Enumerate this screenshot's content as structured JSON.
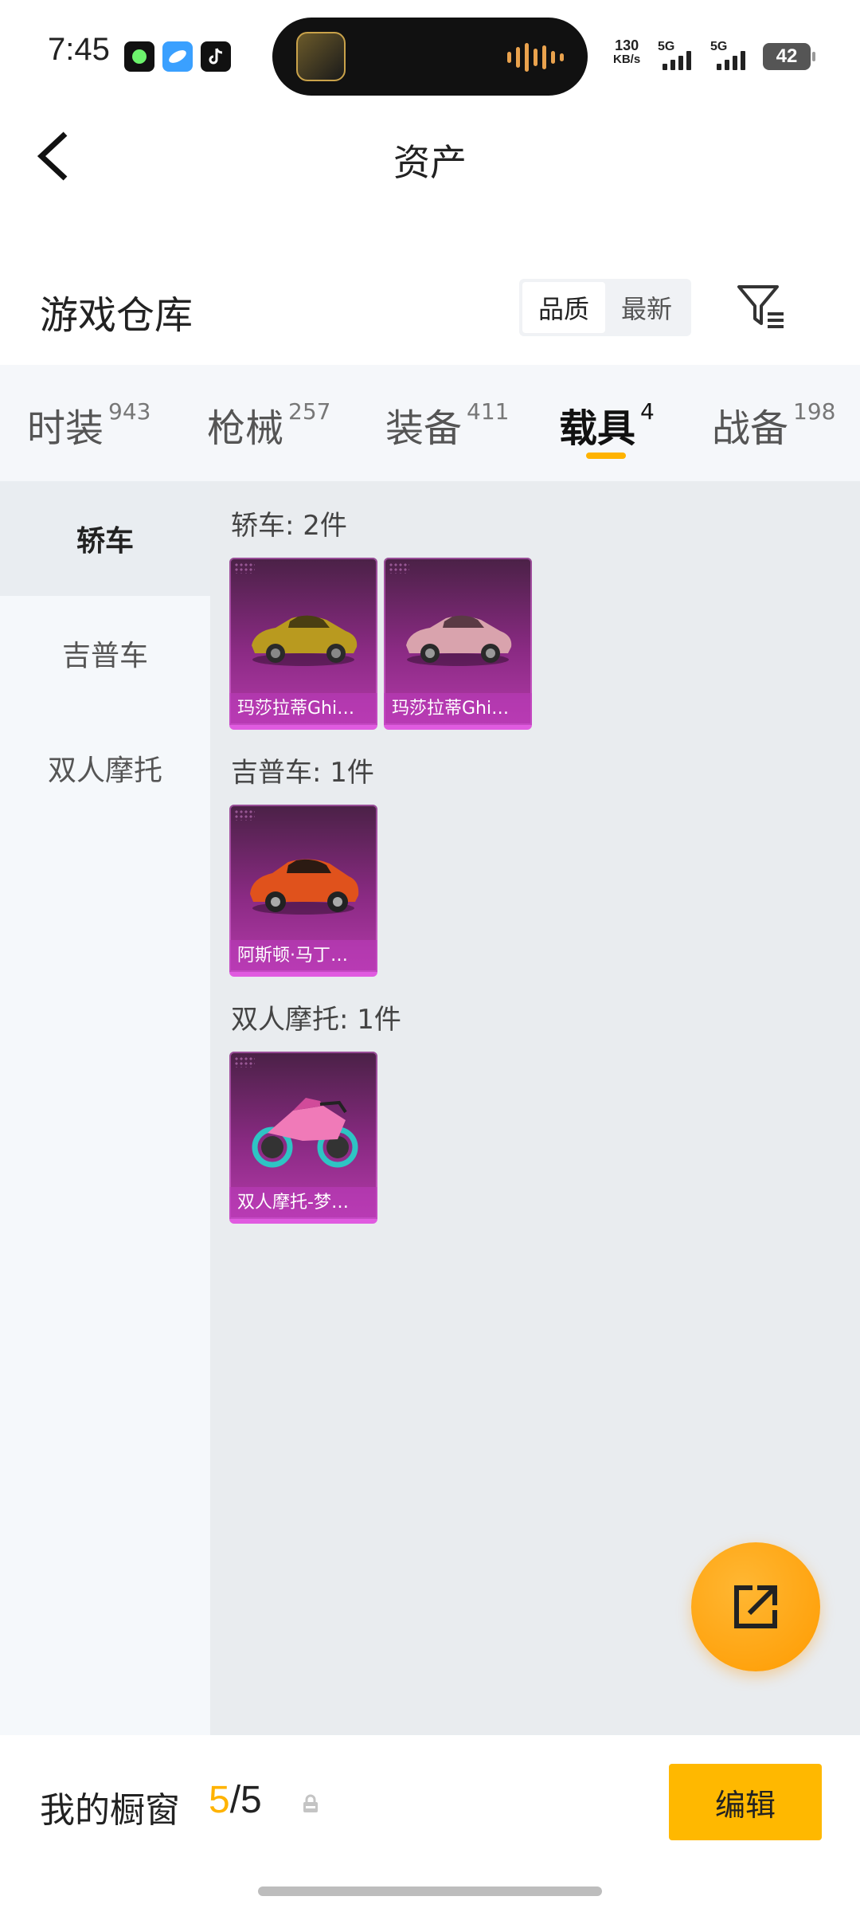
{
  "status_bar": {
    "time": "7:45",
    "net_speed_value": "130",
    "net_speed_unit": "KB/s",
    "sim1": "5G",
    "sim2": "5G",
    "battery": "42"
  },
  "nav": {
    "title": "资产"
  },
  "section": {
    "title": "游戏仓库",
    "sort_options": [
      "品质",
      "最新"
    ],
    "sort_selected": "品质"
  },
  "tabs": [
    {
      "label": "时装",
      "count": "943"
    },
    {
      "label": "枪械",
      "count": "257"
    },
    {
      "label": "装备",
      "count": "411"
    },
    {
      "label": "载具",
      "count": "4"
    },
    {
      "label": "战备",
      "count": "198"
    }
  ],
  "active_tab": "载具",
  "sidebar": [
    {
      "label": "轿车"
    },
    {
      "label": "吉普车"
    },
    {
      "label": "双人摩托"
    }
  ],
  "active_sidebar": "轿车",
  "groups": [
    {
      "title": "轿车: 2件",
      "items": [
        {
          "name": "玛莎拉蒂Ghi…"
        },
        {
          "name": "玛莎拉蒂Ghi…"
        }
      ]
    },
    {
      "title": "吉普车: 1件",
      "items": [
        {
          "name": "阿斯顿·马丁…"
        }
      ]
    },
    {
      "title": "双人摩托: 1件",
      "items": [
        {
          "name": "双人摩托-梦…"
        }
      ]
    }
  ],
  "bottom": {
    "showcase_label": "我的橱窗",
    "showcase_current": "5",
    "showcase_separator": "/",
    "showcase_total": "5",
    "edit_label": "编辑"
  },
  "colors": {
    "accent": "#ffb300",
    "card_purple": "#8a2a83"
  },
  "icons": [
    "back-icon",
    "filter-icon",
    "share-icon",
    "lock-icon"
  ]
}
